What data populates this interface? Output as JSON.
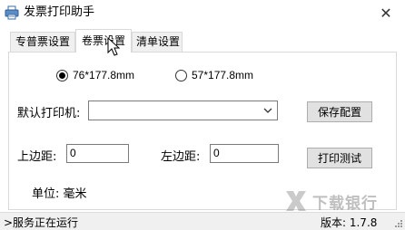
{
  "window": {
    "title": "发票打印助手",
    "app_icon": "printer-icon",
    "close_label": "✕"
  },
  "tabs": [
    {
      "label": "专普票设置",
      "active": false
    },
    {
      "label": "卷票设置",
      "active": true
    },
    {
      "label": "清单设置",
      "active": false
    }
  ],
  "paper_size": {
    "options": [
      {
        "label": "76*177.8mm",
        "selected": true
      },
      {
        "label": "57*177.8mm",
        "selected": false
      }
    ]
  },
  "printer": {
    "label": "默认打印机:",
    "value": "",
    "save_label": "保存配置"
  },
  "margins": {
    "top_label": "上边距:",
    "top_value": "0",
    "left_label": "左边距:",
    "left_value": "0",
    "test_label": "打印测试",
    "unit_label": "单位: 毫米"
  },
  "status": {
    "text": ">服务正在运行",
    "version": "版本: 1.7.8"
  },
  "watermark": {
    "text": "下载银行"
  }
}
